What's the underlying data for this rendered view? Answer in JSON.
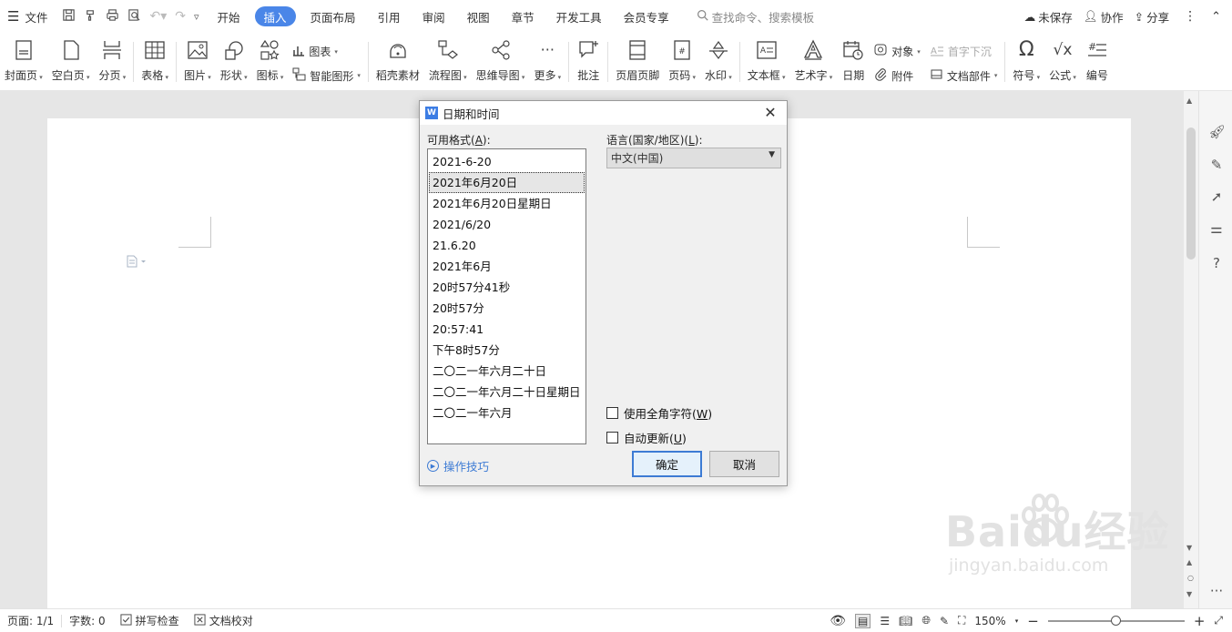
{
  "menubar": {
    "file_menu": "文件",
    "tabs": [
      {
        "label": "开始",
        "active": false
      },
      {
        "label": "插入",
        "active": true
      },
      {
        "label": "页面布局",
        "active": false
      },
      {
        "label": "引用",
        "active": false
      },
      {
        "label": "审阅",
        "active": false
      },
      {
        "label": "视图",
        "active": false
      },
      {
        "label": "章节",
        "active": false
      },
      {
        "label": "开发工具",
        "active": false
      },
      {
        "label": "会员专享",
        "active": false
      }
    ],
    "search_placeholder": "查找命令、搜索模板",
    "unsaved": "未保存",
    "collaborate": "协作",
    "share": "分享"
  },
  "ribbon": {
    "cover": "封面页",
    "blank": "空白页",
    "page_break": "分页",
    "table": "表格",
    "picture": "图片",
    "shape": "形状",
    "icon": "图标",
    "chart": "图表",
    "smart_art": "智能图形",
    "daoke": "稻壳素材",
    "flowchart": "流程图",
    "mindmap": "思维导图",
    "more": "更多",
    "comment": "批注",
    "header_footer": "页眉页脚",
    "page_number": "页码",
    "watermark": "水印",
    "textbox": "文本框",
    "wordart": "艺术字",
    "date": "日期",
    "object": "对象",
    "drop_cap": "首字下沉",
    "attachment": "附件",
    "doc_parts": "文档部件",
    "symbol": "符号",
    "formula": "公式",
    "numbering": "编号"
  },
  "dialog": {
    "title": "日期和时间",
    "formats_label": "可用格式(",
    "formats_key": "A",
    "formats_label_end": "):",
    "formats": [
      "2021-6-20",
      "2021年6月20日",
      "2021年6月20日星期日",
      "2021/6/20",
      "21.6.20",
      "2021年6月",
      "20时57分41秒",
      "20时57分",
      "20:57:41",
      "下午8时57分",
      "二〇二一年六月二十日",
      "二〇二一年六月二十日星期日",
      "二〇二一年六月"
    ],
    "selected_index": 1,
    "language_label": "语言(国家/地区)(",
    "language_key": "L",
    "language_label_end": "):",
    "language_value": "中文(中国)",
    "fullwidth_label": "使用全角字符(",
    "fullwidth_key": "W",
    "fullwidth_end": ")",
    "fullwidth_checked": false,
    "autoupdate_label": "自动更新(",
    "autoupdate_key": "U",
    "autoupdate_end": ")",
    "autoupdate_checked": false,
    "tips": "操作技巧",
    "ok": "确定",
    "cancel": "取消"
  },
  "status": {
    "page": "页面: 1/1",
    "words": "字数: 0",
    "spell": "拼写检查",
    "proof": "文档校对",
    "zoom": "150%",
    "zoom_fraction": 0.5
  },
  "watermark": {
    "main": "Baidu经验",
    "sub": "jingyan.baidu.com"
  },
  "colors": {
    "accent": "#4a86e8",
    "link": "#3d7bd4"
  }
}
